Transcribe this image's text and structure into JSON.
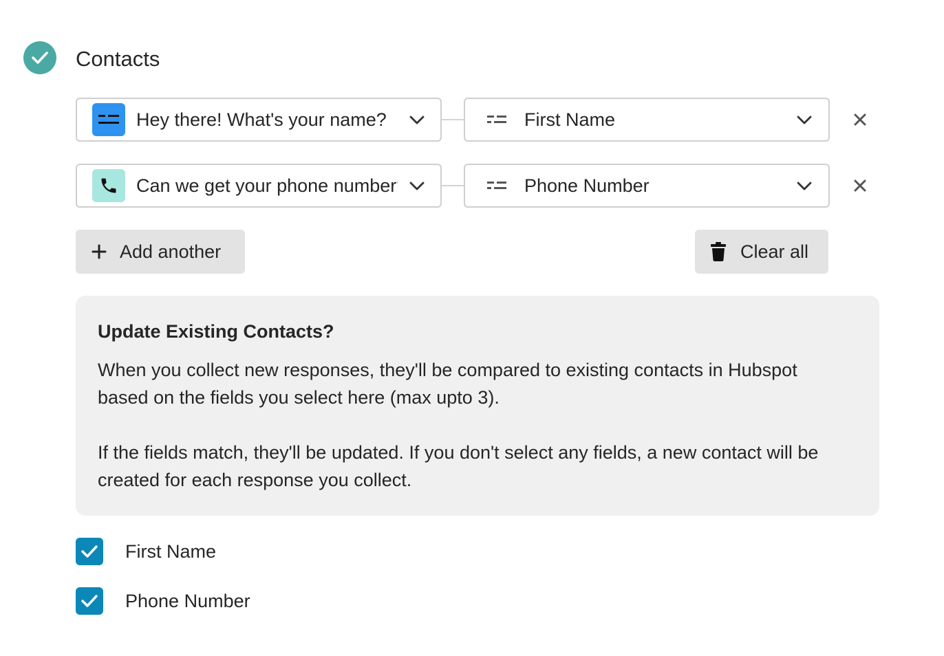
{
  "section": {
    "title": "Contacts",
    "status_icon": "check-circle-icon",
    "status_color": "#4aa9a3"
  },
  "mappings": [
    {
      "question_icon": "short-text-icon",
      "question_icon_color": "#2e93f0",
      "question_label": "Hey there! What's your name?",
      "field_icon": "field-text-icon",
      "field_label": "First Name"
    },
    {
      "question_icon": "phone-icon",
      "question_icon_color": "#a8e7df",
      "question_label": "Can we get your phone number?",
      "field_icon": "field-text-icon",
      "field_label": "Phone Number"
    }
  ],
  "actions": {
    "add_label": "Add another",
    "add_icon": "plus-icon",
    "clear_label": "Clear all",
    "clear_icon": "trash-icon"
  },
  "info": {
    "title": "Update Existing Contacts?",
    "paragraph_1": "When you collect new responses, they'll be compared to existing contacts in Hubspot based on the fields you select here (max upto 3).",
    "paragraph_2": "If the fields match, they'll be updated. If you don't select any fields, a new contact will be created for each response you collect."
  },
  "match_fields": [
    {
      "label": "First Name",
      "checked": true
    },
    {
      "label": "Phone Number",
      "checked": true
    }
  ],
  "colors": {
    "checkbox": "#0b88b8",
    "button_bg": "#e3e3e3",
    "info_bg": "#f0f0f0"
  }
}
